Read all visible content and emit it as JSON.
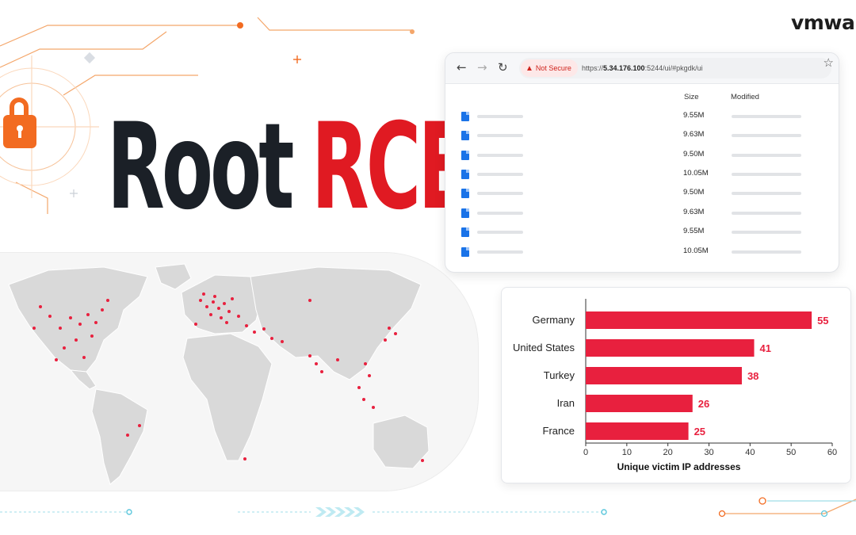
{
  "brand": {
    "name": "vmwa"
  },
  "headline": {
    "word1": "Root",
    "word2": "RCE"
  },
  "browser": {
    "back_icon": "arrow-left-icon",
    "forward_icon": "arrow-right-icon",
    "reload_icon": "reload-icon",
    "security_label": "Not Secure",
    "url_prefix": "https://",
    "url_host": "5.34.176.100",
    "url_rest": ":5244/ui/#pkgdk/ui",
    "bookmark_icon": "star-icon",
    "columns": {
      "size": "Size",
      "modified": "Modified"
    },
    "files": [
      {
        "size": "9.55M"
      },
      {
        "size": "9.63M"
      },
      {
        "size": "9.50M"
      },
      {
        "size": "10.05M"
      },
      {
        "size": "9.50M"
      },
      {
        "size": "9.63M"
      },
      {
        "size": "9.55M"
      },
      {
        "size": "10.05M"
      }
    ]
  },
  "colors": {
    "accent": "#e01a22",
    "bar": "#e8203e",
    "lock": "#f26b21",
    "title_dark": "#1b2027"
  },
  "chart_data": {
    "type": "bar",
    "orientation": "horizontal",
    "categories": [
      "Germany",
      "United States",
      "Turkey",
      "Iran",
      "France"
    ],
    "values": [
      55,
      41,
      38,
      26,
      25
    ],
    "xlabel": "Unique victim IP addresses",
    "xlim": [
      0,
      60
    ],
    "xticks": [
      0,
      10,
      20,
      30,
      40,
      50,
      60
    ],
    "grid": false
  }
}
